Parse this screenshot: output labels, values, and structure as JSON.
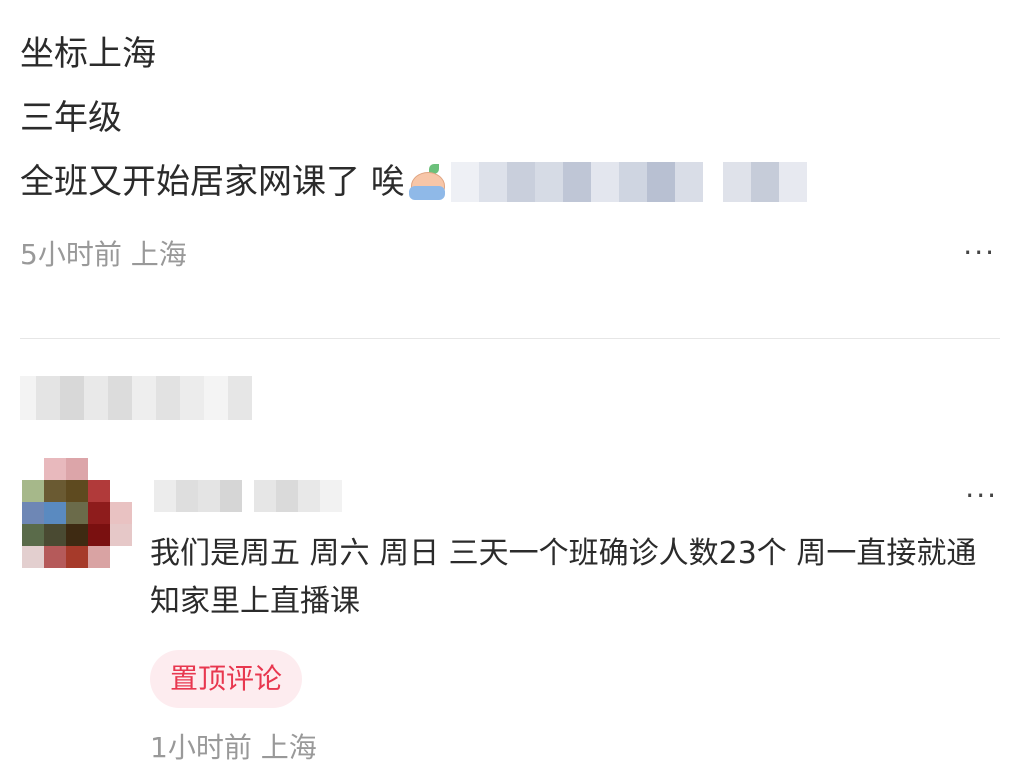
{
  "post": {
    "lines": [
      "坐标上海",
      "三年级",
      "全班又开始居家网课了 唉"
    ],
    "emoji": "crying-face-emoji",
    "meta": "5小时前 上海",
    "more": "···"
  },
  "comment": {
    "text": "我们是周五 周六 周日 三天一个班确诊人数23个 周一直接就通知家里上直播课",
    "badge": "置顶评论",
    "meta": "1小时前 上海",
    "more": "···"
  },
  "colors": {
    "badge_bg": "#fdecef",
    "badge_text": "#e8374f",
    "meta_text": "#999999"
  }
}
